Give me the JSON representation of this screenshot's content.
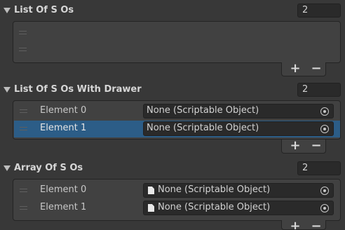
{
  "lists": [
    {
      "title": "List Of S Os",
      "count": "2",
      "elements": []
    },
    {
      "title": "List Of S Os With Drawer",
      "count": "2",
      "elements": [
        {
          "label": "Element 0",
          "value": "None (Scriptable Object)"
        },
        {
          "label": "Element 1",
          "value": "None (Scriptable Object)"
        }
      ]
    },
    {
      "title": "Array Of S Os",
      "count": "2",
      "elements": [
        {
          "label": "Element 0",
          "value": "None (Scriptable Object)"
        },
        {
          "label": "Element 1",
          "value": "None (Scriptable Object)"
        }
      ]
    }
  ],
  "buttons": {
    "add": "+",
    "remove": "−"
  },
  "colors": {
    "background": "#383838",
    "selected_row": "#2c5d87",
    "field": "#2a2a2a"
  }
}
